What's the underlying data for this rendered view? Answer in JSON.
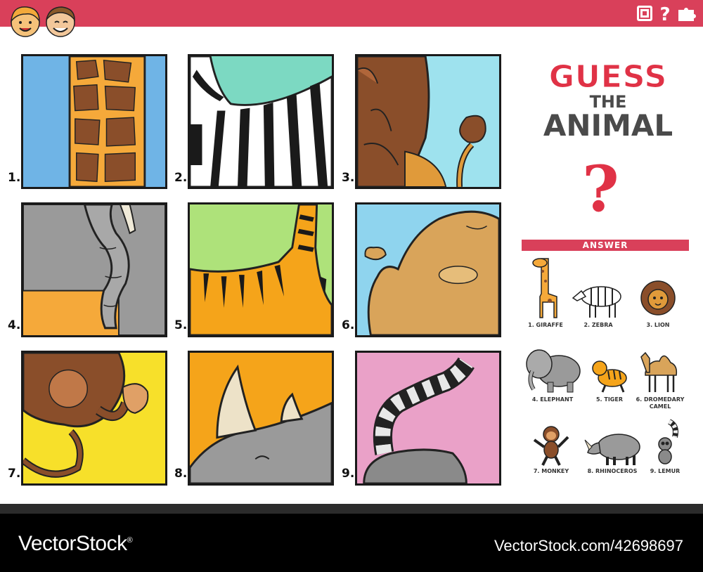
{
  "header": {
    "icons": [
      "frame-icon",
      "question-icon",
      "puzzle-icon"
    ]
  },
  "panels": [
    {
      "number": "1.",
      "animal": "giraffe"
    },
    {
      "number": "2.",
      "animal": "zebra"
    },
    {
      "number": "3.",
      "animal": "lion"
    },
    {
      "number": "4.",
      "animal": "elephant"
    },
    {
      "number": "5.",
      "animal": "tiger"
    },
    {
      "number": "6.",
      "animal": "camel"
    },
    {
      "number": "7.",
      "animal": "monkey"
    },
    {
      "number": "8.",
      "animal": "rhinoceros"
    },
    {
      "number": "9.",
      "animal": "lemur"
    }
  ],
  "title": {
    "line1": "GUESS",
    "line2": "THE",
    "line3": "ANIMAL",
    "question_mark": "?"
  },
  "answer": {
    "heading": "ANSWER",
    "items": [
      {
        "label": "1. GIRAFFE"
      },
      {
        "label": "2. ZEBRA"
      },
      {
        "label": "3. LION"
      },
      {
        "label": "4. ELEPHANT"
      },
      {
        "label": "5. TIGER"
      },
      {
        "label": "6. DROMEDARY CAMEL"
      },
      {
        "label": "7. MONKEY"
      },
      {
        "label": "8. RHINOCEROS"
      },
      {
        "label": "9. LEMUR"
      }
    ]
  },
  "footer": {
    "brand": "VectorStock",
    "brand_mark": "®",
    "image_id": "VectorStock.com/42698697"
  },
  "colors": {
    "accent_red": "#d9405a",
    "title_red": "#e03246",
    "title_gray": "#4a4a4a"
  }
}
